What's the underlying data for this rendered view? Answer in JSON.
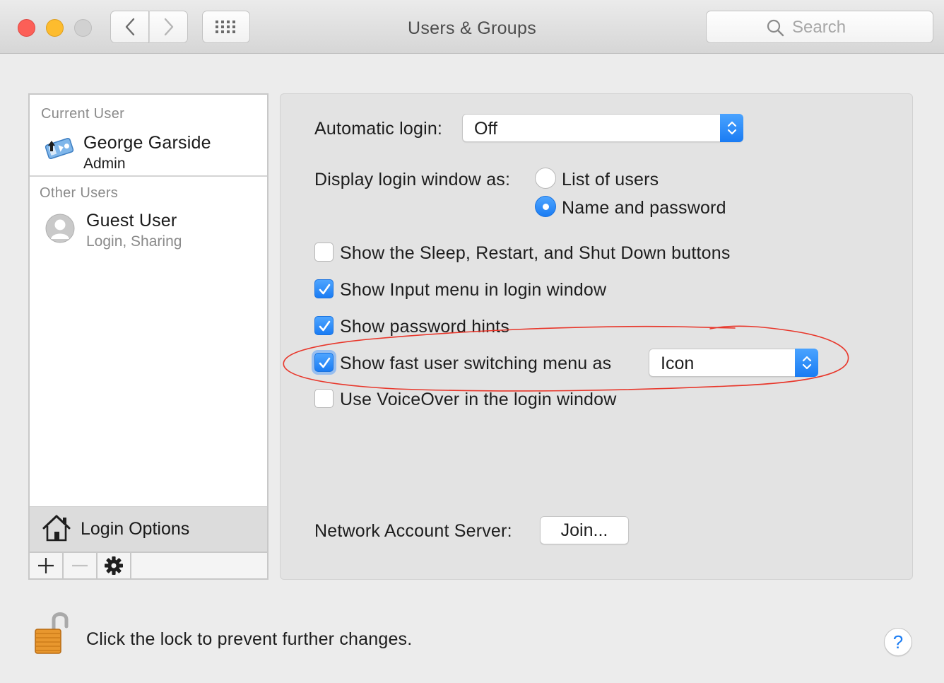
{
  "window": {
    "title": "Users & Groups"
  },
  "toolbar": {
    "search_placeholder": "Search",
    "back_icon": "chevron-left-icon",
    "forward_icon": "chevron-right-icon",
    "grid_icon": "show-all-grid-icon"
  },
  "sidebar": {
    "current_user_label": "Current User",
    "current_user": {
      "name": "George Garside",
      "role": "Admin"
    },
    "other_users_label": "Other Users",
    "other_users": [
      {
        "name": "Guest User",
        "detail": "Login, Sharing"
      }
    ],
    "login_options_label": "Login Options",
    "buttons": {
      "add": "+",
      "remove": "−"
    }
  },
  "login_options": {
    "automatic_login_label": "Automatic login:",
    "automatic_login_value": "Off",
    "display_login_label": "Display login window as:",
    "display_options": [
      {
        "label": "List of users",
        "selected": false
      },
      {
        "label": "Name and password",
        "selected": true
      }
    ],
    "checkboxes": [
      {
        "label": "Show the Sleep, Restart, and Shut Down buttons",
        "checked": false
      },
      {
        "label": "Show Input menu in login window",
        "checked": true
      },
      {
        "label": "Show password hints",
        "checked": true
      },
      {
        "label": "Show fast user switching menu as",
        "checked": true
      },
      {
        "label": "Use VoiceOver in the login window",
        "checked": false
      }
    ],
    "fast_user_switching_value": "Icon",
    "network_account_label": "Network Account Server:",
    "join_button": "Join..."
  },
  "footer": {
    "lock_text": "Click the lock to prevent further changes.",
    "help_label": "?"
  },
  "colors": {
    "accent": "#1a7cf3",
    "annotation_red": "#e8372b",
    "close": "#fc5f57",
    "minimize": "#fdbc2e"
  }
}
